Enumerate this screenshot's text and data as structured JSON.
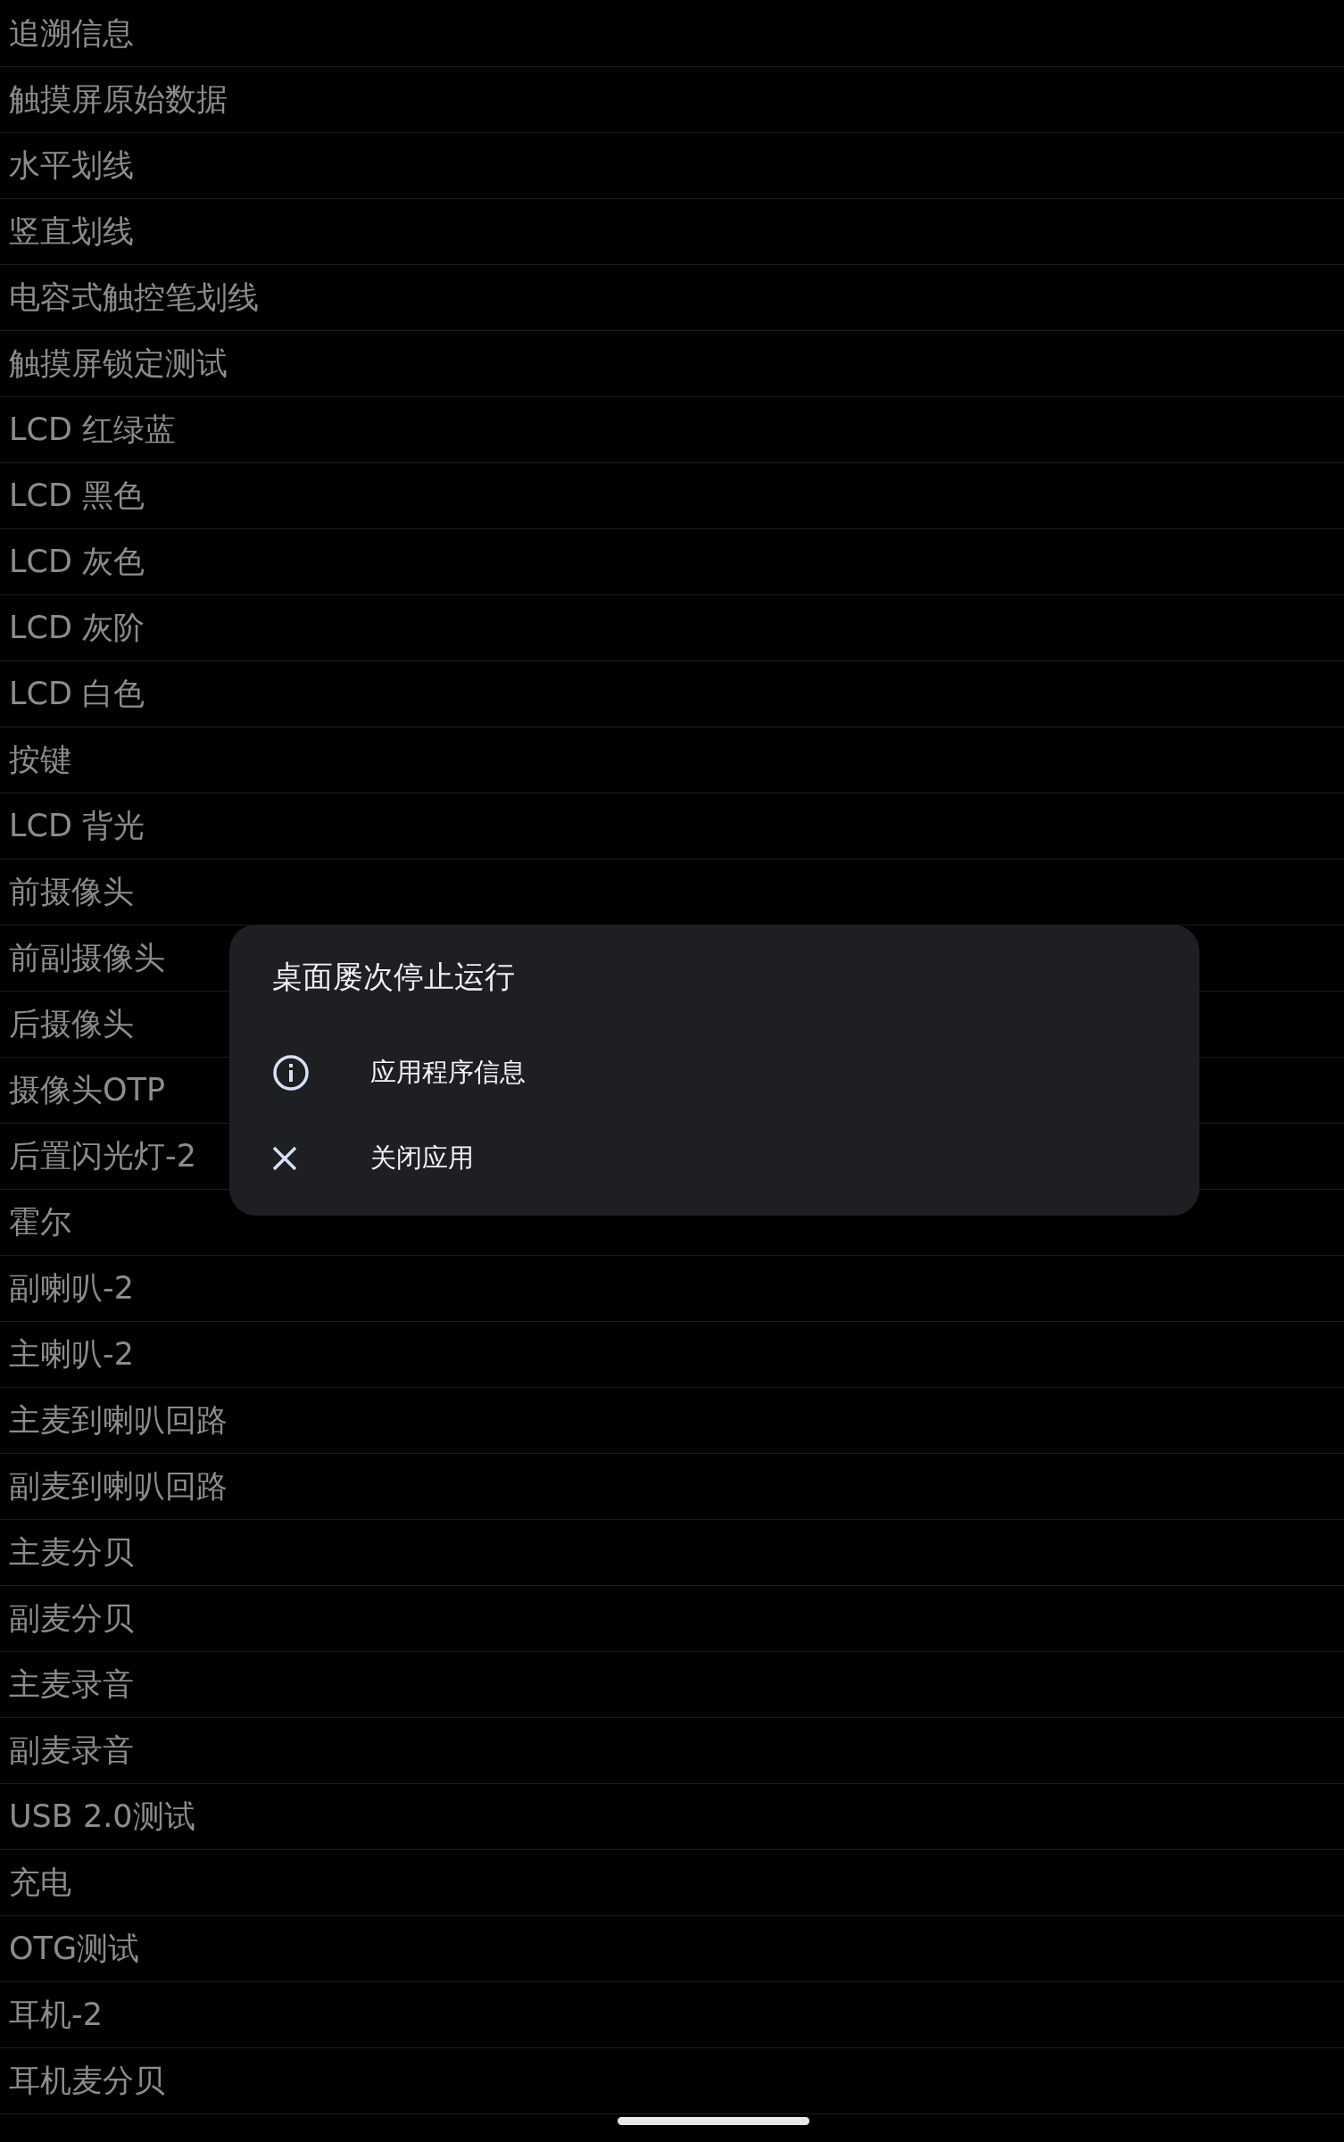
{
  "list": {
    "items": [
      "追溯信息",
      "触摸屏原始数据",
      "水平划线",
      "竖直划线",
      "电容式触控笔划线",
      "触摸屏锁定测试",
      "LCD 红绿蓝",
      "LCD 黑色",
      "LCD 灰色",
      "LCD 灰阶",
      "LCD 白色",
      "按键",
      "LCD 背光",
      "前摄像头",
      "前副摄像头",
      "后摄像头",
      "摄像头OTP",
      "后置闪光灯-2",
      "霍尔",
      "副喇叭-2",
      "主喇叭-2",
      "主麦到喇叭回路",
      "副麦到喇叭回路",
      "主麦分贝",
      "副麦分贝",
      "主麦录音",
      "副麦录音",
      "USB 2.0测试",
      "充电",
      "OTG测试",
      "耳机-2",
      "耳机麦分贝"
    ]
  },
  "dialog": {
    "title": "桌面屡次停止运行",
    "actions": [
      {
        "kind": "info",
        "label": "应用程序信息"
      },
      {
        "kind": "close",
        "label": "关闭应用"
      }
    ]
  }
}
